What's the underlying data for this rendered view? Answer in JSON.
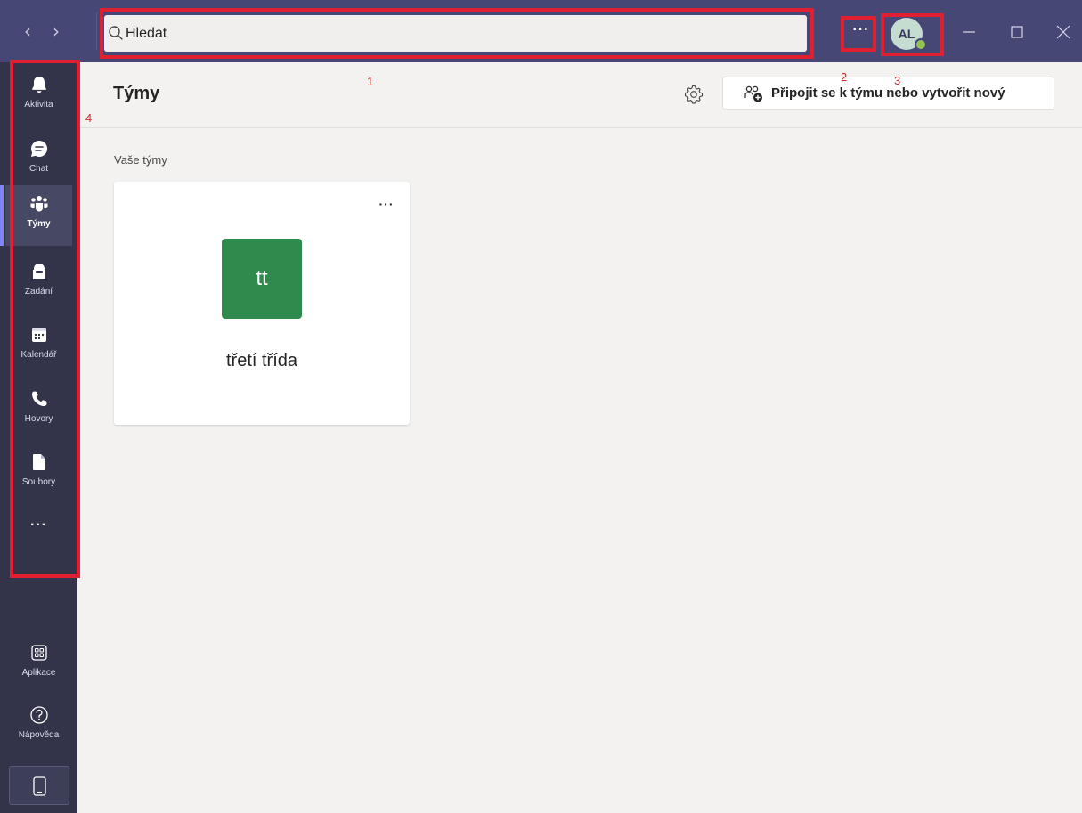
{
  "titlebar": {
    "back_glyph": "‹",
    "forward_glyph": "›",
    "search": {
      "placeholder": "Hledat",
      "icon": "search-icon"
    },
    "more_glyph": "···",
    "avatar_initials": "AL",
    "presence_status": "available",
    "window_controls": [
      "minimize-icon",
      "maximize-icon",
      "close-icon"
    ]
  },
  "annotations": [
    "1",
    "2",
    "3",
    "4"
  ],
  "rail": {
    "items": [
      {
        "label": "Aktivita",
        "icon": "bell-icon",
        "active": false
      },
      {
        "label": "Chat",
        "icon": "chat-icon",
        "active": false
      },
      {
        "label": "Týmy",
        "icon": "teams-icon",
        "active": true
      },
      {
        "label": "Zadání",
        "icon": "assignments-icon",
        "active": false
      },
      {
        "label": "Kalendář",
        "icon": "calendar-icon",
        "active": false
      },
      {
        "label": "Hovory",
        "icon": "phone-icon",
        "active": false
      },
      {
        "label": "Soubory",
        "icon": "file-icon",
        "active": false
      }
    ],
    "more_glyph": "···",
    "bottom_items": [
      {
        "label": "Aplikace",
        "icon": "apps-icon"
      },
      {
        "label": "Nápověda",
        "icon": "help-icon"
      }
    ],
    "device_icon": "mobile-device-icon"
  },
  "main": {
    "title": "Týmy",
    "settings_icon": "gear-icon",
    "join_button_label": "Připojit se k týmu nebo vytvořit nový",
    "section_label": "Vaše týmy",
    "teams": [
      {
        "initials": "tt",
        "name": "třetí třída",
        "color": "#2e8b4d",
        "more_glyph": "···"
      }
    ]
  },
  "colors": {
    "titlebar": "#464775",
    "rail": "#33344a",
    "background": "#f3f2f1",
    "annotation": "#e02030"
  }
}
